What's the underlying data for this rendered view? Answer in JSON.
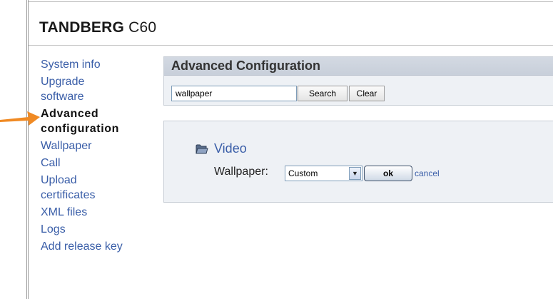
{
  "header": {
    "brand_bold": "TANDBERG",
    "brand_model": "C60"
  },
  "sidebar": {
    "items": [
      {
        "label": "System info"
      },
      {
        "label": "Upgrade\nsoftware"
      },
      {
        "label": "Advanced\nconfiguration",
        "active": true
      },
      {
        "label": "Wallpaper"
      },
      {
        "label": "Call"
      },
      {
        "label": "Upload\ncertificates"
      },
      {
        "label": "XML files"
      },
      {
        "label": "Logs"
      },
      {
        "label": "Add release key"
      }
    ]
  },
  "advanced": {
    "title": "Advanced Configuration",
    "search_value": "wallpaper",
    "search_button": "Search",
    "clear_button": "Clear"
  },
  "config": {
    "section": "Video",
    "field_label": "Wallpaper:",
    "field_value": "Custom",
    "ok_button": "ok",
    "cancel_link": "cancel"
  },
  "colors": {
    "link": "#3a5ea8",
    "pointer_arrow": "#f08a24",
    "panel_bg": "#eef1f5"
  }
}
